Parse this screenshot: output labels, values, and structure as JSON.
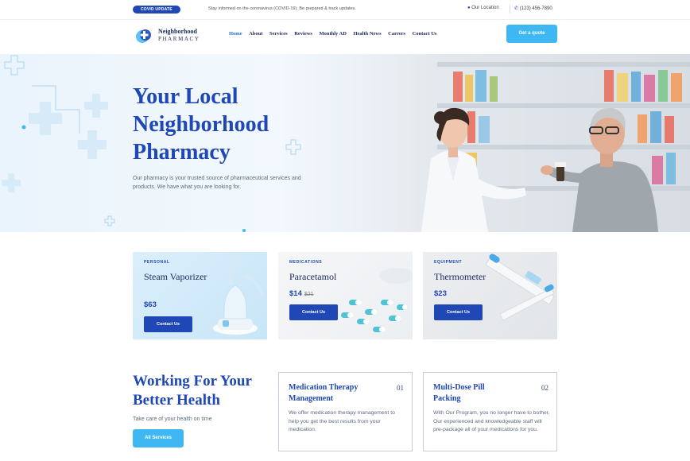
{
  "topbar": {
    "badge": "COVID UPDATE",
    "notice": "Stay informed on the coronavirus (COVID-19). Be prepared & track updates.",
    "location": "Our Location",
    "phone": "(123) 456-7890"
  },
  "header": {
    "logo_name": "Neighborhood",
    "logo_sub": "PHARMACY",
    "nav": [
      "Home",
      "About",
      "Services",
      "Reviews",
      "Monthly AD",
      "Health News",
      "Carrers",
      "Contact Us"
    ],
    "quote_button": "Get a quote"
  },
  "hero": {
    "title_lines": [
      "Your Local",
      "Neighborhood",
      "Pharmacy"
    ],
    "description": "Our pharmacy is your trusted source of pharmaceutical services and products. We have what you are looking for."
  },
  "products": [
    {
      "category": "PERSONAL",
      "name": "Steam Vaporizer",
      "price": "$63",
      "old_price": "",
      "button": "Contact Us"
    },
    {
      "category": "MEDICATIONS",
      "name": "Paracetamol",
      "price": "$14",
      "old_price": "$21",
      "button": "Contact Us"
    },
    {
      "category": "EQUIPMENT",
      "name": "Thermometer",
      "price": "$23",
      "old_price": "",
      "button": "Contact Us"
    }
  ],
  "health": {
    "title_lines": [
      "Working For Your",
      "Better Health"
    ],
    "subtitle": "Take care of your health on time",
    "button": "All Services"
  },
  "services": [
    {
      "title": "Medication Therapy Management",
      "number": "01",
      "text": "We offer medication therapy management to help you get the best results from your medication."
    },
    {
      "title": "Multi-Dose Pill Packing",
      "number": "02",
      "text": "With Our Program, you no longer have to bother. Our experienced and knowledgeable staff will pre-package all of your medications for you."
    }
  ],
  "colors": {
    "brand": "#1f47b5",
    "accent": "#3eb7f3",
    "heading": "#1b2b5a"
  }
}
